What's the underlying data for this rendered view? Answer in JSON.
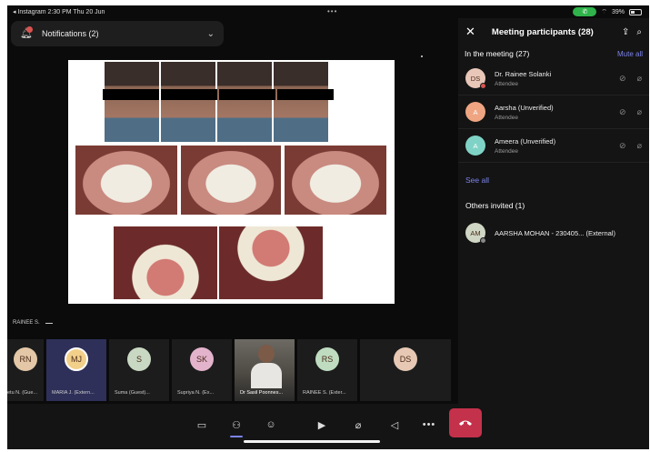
{
  "status_bar": {
    "left": "◂ Instagram  2:30 PM  Thu 20 Jun",
    "dots": "•••",
    "battery": "39%",
    "call_color": "#2fb34a"
  },
  "notification": {
    "label": "Notifications (2)",
    "icon": "bell-icon",
    "chevron": "chevron-down-icon"
  },
  "panel": {
    "title": "Meeting participants (28)",
    "in_meeting": "In the meeting (27)",
    "mute_all": "Mute all",
    "participants": [
      {
        "initials": "DS",
        "name": "Dr. Rainee Solanki",
        "role": "Attendee",
        "color": "#e8c6b8"
      },
      {
        "initials": "A",
        "name": "Aarsha (Unverified)",
        "role": "Attendee",
        "color": "#f0a582"
      },
      {
        "initials": "A",
        "name": "Ameera (Unverified)",
        "role": "Attendee",
        "color": "#7fd3c6"
      }
    ],
    "see_all": "See all",
    "others_invited": "Others invited (1)",
    "external": {
      "initials": "AM",
      "name": "AARSHA MOHAN - 230405... (External)",
      "color": "#cfd6c4"
    },
    "accent": "#7b83eb"
  },
  "strip": {
    "label": "RAINEE S.",
    "tiles": [
      {
        "initials": "RN",
        "name": "etu N. (Gue...",
        "color": "#e3c7a6"
      },
      {
        "initials": "MJ",
        "name": "MARIA J. (Extern...",
        "color": "#f3d08a"
      },
      {
        "initials": "S",
        "name": "Suma (Guest)...",
        "color": "#c8d8c2"
      },
      {
        "initials": "SK",
        "name": "Supriya N. (Ex...",
        "color": "#e3b3cc"
      },
      {
        "initials": "",
        "name": "Dr Sasil Poonnes...",
        "color": ""
      },
      {
        "initials": "RS",
        "name": "RAINEE S. (Exter...",
        "color": "#bfdcc0"
      },
      {
        "initials": "DS",
        "name": "",
        "color": "#e6c8b4"
      }
    ]
  },
  "controls": {
    "chat": "chat-icon",
    "people": "people-icon",
    "reactions": "reactions-icon",
    "camera": "camera-off-icon",
    "mic": "mic-off-icon",
    "speaker": "speaker-off-icon",
    "more": "•••",
    "leave": "leave-call-icon",
    "leave_color": "#c4314b"
  }
}
